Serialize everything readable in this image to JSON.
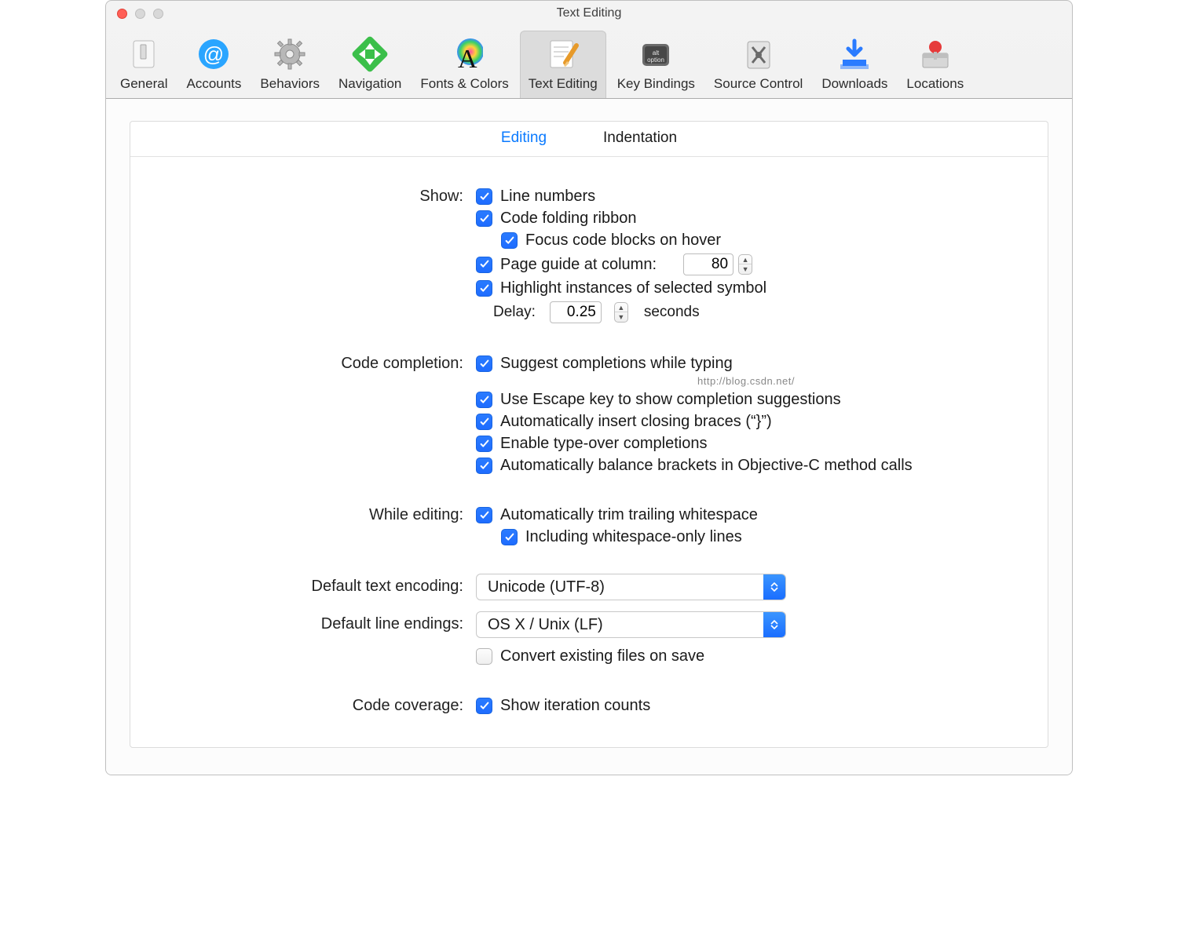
{
  "window": {
    "title": "Text Editing"
  },
  "toolbar": {
    "items": [
      {
        "label": "General"
      },
      {
        "label": "Accounts"
      },
      {
        "label": "Behaviors"
      },
      {
        "label": "Navigation"
      },
      {
        "label": "Fonts & Colors"
      },
      {
        "label": "Text Editing"
      },
      {
        "label": "Key Bindings"
      },
      {
        "label": "Source Control"
      },
      {
        "label": "Downloads"
      },
      {
        "label": "Locations"
      }
    ]
  },
  "tabs": {
    "editing": "Editing",
    "indentation": "Indentation"
  },
  "sections": {
    "show": {
      "label": "Show:",
      "line_numbers": "Line numbers",
      "code_folding": "Code folding ribbon",
      "focus_hover": "Focus code blocks on hover",
      "page_guide": "Page guide at column:",
      "page_guide_value": "80",
      "highlight_sel": "Highlight instances of selected symbol",
      "delay_label": "Delay:",
      "delay_value": "0.25",
      "delay_unit": "seconds"
    },
    "completion": {
      "label": "Code completion:",
      "suggest": "Suggest completions while typing",
      "watermark": "http://blog.csdn.net/",
      "escape": "Use Escape key to show completion suggestions",
      "braces": "Automatically insert closing braces (“}”)",
      "typeover": "Enable type-over completions",
      "balance": "Automatically balance brackets in Objective-C method calls"
    },
    "editing": {
      "label": "While editing:",
      "trim": "Automatically trim trailing whitespace",
      "including_ws": "Including whitespace-only lines"
    },
    "encoding": {
      "label": "Default text encoding:",
      "value": "Unicode (UTF-8)"
    },
    "lineend": {
      "label": "Default line endings:",
      "value": "OS X / Unix (LF)",
      "convert": "Convert existing files on save"
    },
    "coverage": {
      "label": "Code coverage:",
      "show_iter": "Show iteration counts"
    }
  }
}
